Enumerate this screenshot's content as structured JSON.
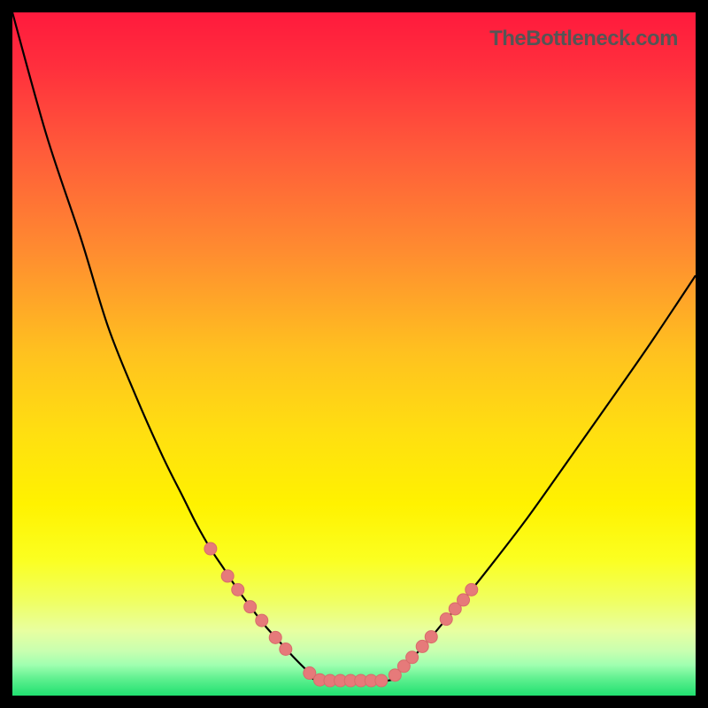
{
  "watermark": "TheBottleneck.com",
  "colors": {
    "marker_fill": "#e67a7a",
    "marker_stroke": "#d86b6b",
    "curve": "#000000",
    "gradient_stops": [
      {
        "offset": 0.0,
        "color": "#ff1a3d"
      },
      {
        "offset": 0.08,
        "color": "#ff2f3d"
      },
      {
        "offset": 0.2,
        "color": "#ff5a3a"
      },
      {
        "offset": 0.35,
        "color": "#ff8c30"
      },
      {
        "offset": 0.5,
        "color": "#ffc21f"
      },
      {
        "offset": 0.62,
        "color": "#ffe010"
      },
      {
        "offset": 0.72,
        "color": "#fff200"
      },
      {
        "offset": 0.8,
        "color": "#fbff20"
      },
      {
        "offset": 0.86,
        "color": "#f0ff60"
      },
      {
        "offset": 0.905,
        "color": "#e8ffa0"
      },
      {
        "offset": 0.935,
        "color": "#c8ffb0"
      },
      {
        "offset": 0.955,
        "color": "#a0ffb0"
      },
      {
        "offset": 0.975,
        "color": "#60f090"
      },
      {
        "offset": 1.0,
        "color": "#20e070"
      }
    ]
  },
  "chart_data": {
    "type": "line",
    "title": "",
    "xlabel": "",
    "ylabel": "",
    "xlim": [
      0,
      100
    ],
    "ylim": [
      0,
      100
    ],
    "curve_left": {
      "x": [
        0,
        5,
        10,
        14,
        18,
        22,
        25,
        27,
        29,
        31,
        33,
        35,
        37,
        39,
        41,
        43,
        45
      ],
      "y": [
        100,
        82,
        67,
        54,
        44,
        35,
        29,
        25,
        21.5,
        18.5,
        15.5,
        12.8,
        10.2,
        8.0,
        5.8,
        3.8,
        2.2
      ]
    },
    "curve_right": {
      "x": [
        55,
        57,
        59,
        61,
        63,
        66,
        70,
        75,
        80,
        86,
        93,
        100
      ],
      "y": [
        2.2,
        4.0,
        6.0,
        8.2,
        10.6,
        14.0,
        19.0,
        25.5,
        32.5,
        41.0,
        51.0,
        61.5
      ]
    },
    "flat_bottom": {
      "x": [
        45,
        55
      ],
      "y": [
        2.2,
        2.2
      ]
    },
    "markers": [
      {
        "x": 29.0,
        "y": 21.5
      },
      {
        "x": 31.5,
        "y": 17.5
      },
      {
        "x": 33.0,
        "y": 15.5
      },
      {
        "x": 34.8,
        "y": 13.0
      },
      {
        "x": 36.5,
        "y": 11.0
      },
      {
        "x": 38.5,
        "y": 8.5
      },
      {
        "x": 40.0,
        "y": 6.8
      },
      {
        "x": 43.5,
        "y": 3.3
      },
      {
        "x": 45.0,
        "y": 2.3
      },
      {
        "x": 46.5,
        "y": 2.2
      },
      {
        "x": 48.0,
        "y": 2.2
      },
      {
        "x": 49.5,
        "y": 2.2
      },
      {
        "x": 51.0,
        "y": 2.2
      },
      {
        "x": 52.5,
        "y": 2.2
      },
      {
        "x": 54.0,
        "y": 2.2
      },
      {
        "x": 56.0,
        "y": 3.0
      },
      {
        "x": 57.3,
        "y": 4.3
      },
      {
        "x": 58.5,
        "y": 5.6
      },
      {
        "x": 60.0,
        "y": 7.2
      },
      {
        "x": 61.3,
        "y": 8.6
      },
      {
        "x": 63.5,
        "y": 11.2
      },
      {
        "x": 64.8,
        "y": 12.7
      },
      {
        "x": 66.0,
        "y": 14.0
      },
      {
        "x": 67.2,
        "y": 15.5
      }
    ]
  }
}
